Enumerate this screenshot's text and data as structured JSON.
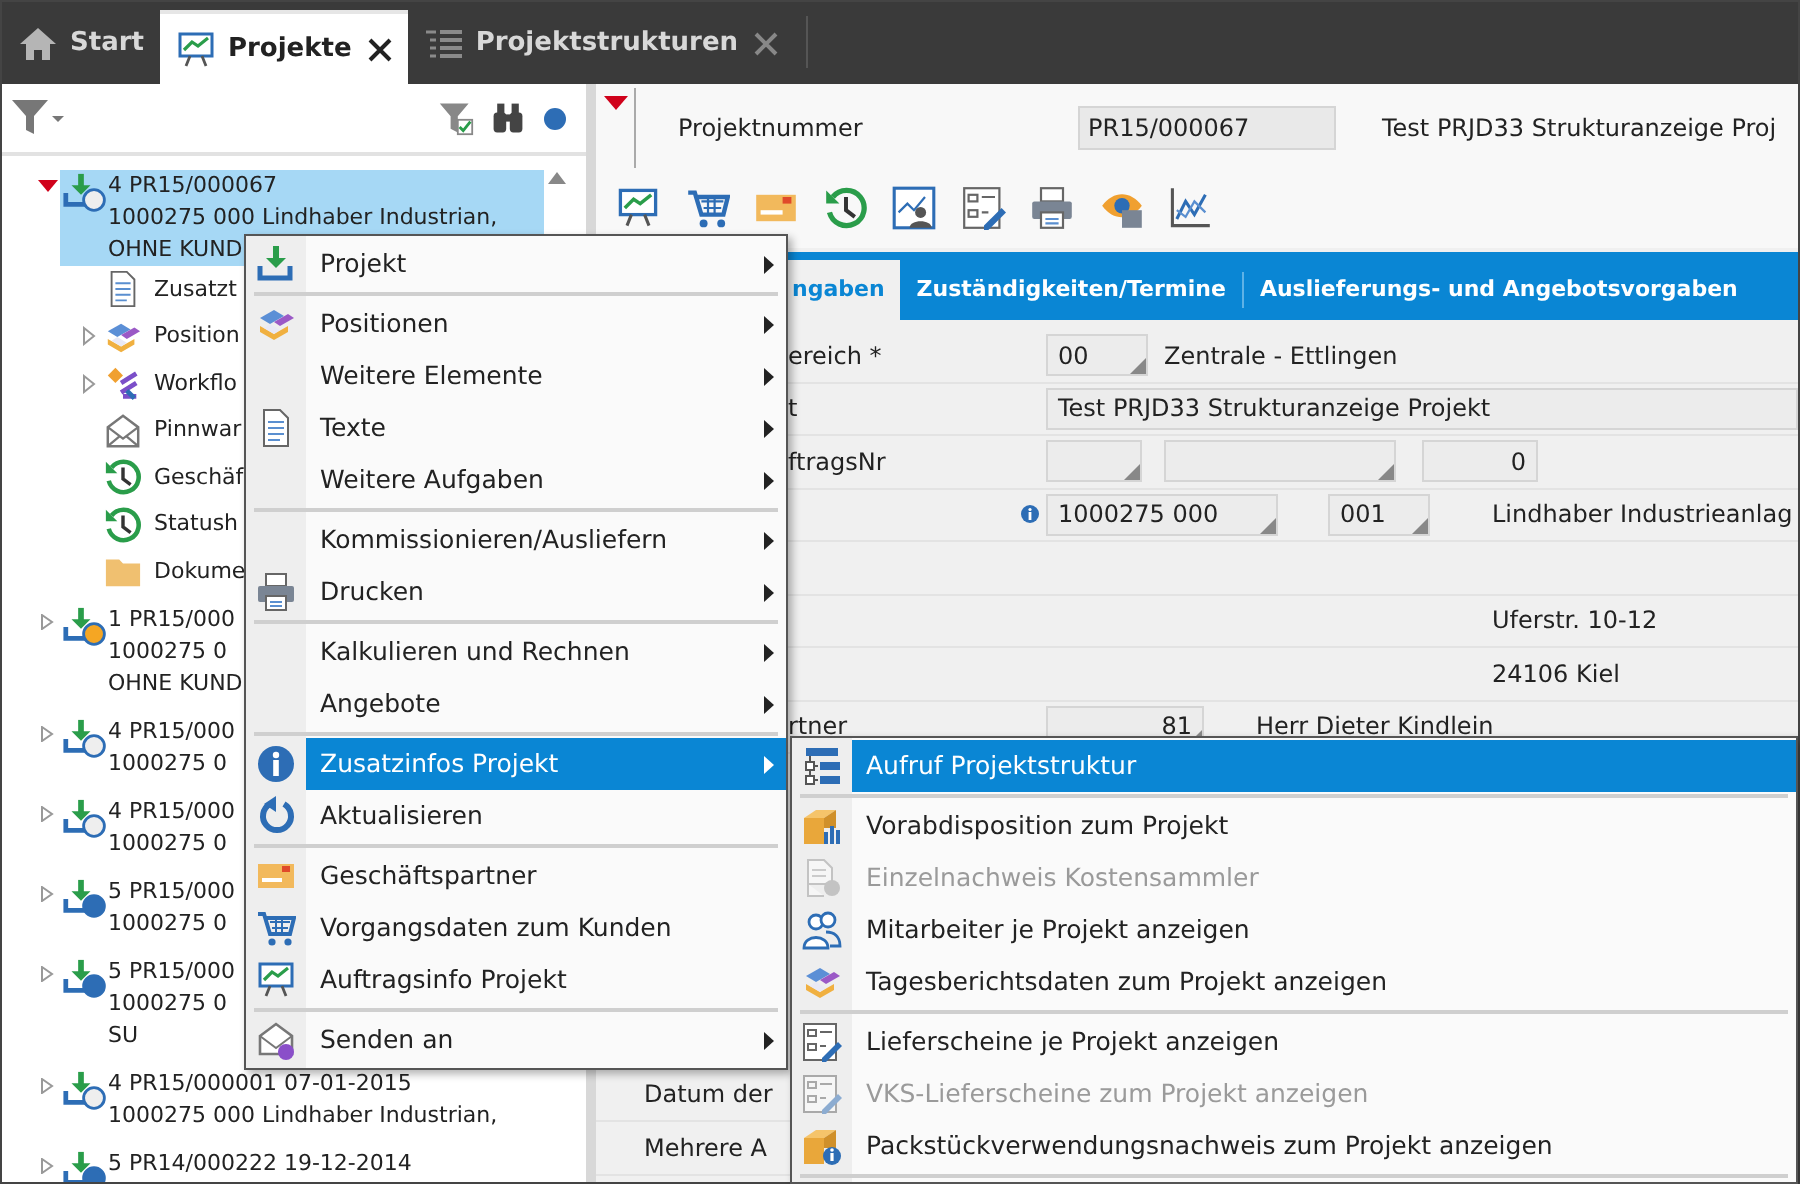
{
  "tabs": [
    {
      "label": "Start",
      "kind": "home",
      "selected": false,
      "closable": false
    },
    {
      "label": "Projekte",
      "kind": "chart",
      "selected": true,
      "closable": true
    },
    {
      "label": "Projektstrukturen",
      "kind": "structure",
      "selected": false,
      "closable": true
    }
  ],
  "tree": [
    {
      "lines": [
        "4 PR15/000067",
        "1000275 000 Lindhaber Industrian,",
        "OHNE KUND"
      ],
      "color": "#eeeeee",
      "selected": true,
      "expanded": true,
      "children": [
        {
          "label": "Zusatzt",
          "kind": "doc",
          "expandable": false
        },
        {
          "label": "Position",
          "kind": "blocks",
          "expandable": true
        },
        {
          "label": "Workflo",
          "kind": "workflow",
          "expandable": true
        },
        {
          "label": "Pinnwar",
          "kind": "envelope",
          "expandable": false
        },
        {
          "label": "Geschäf",
          "kind": "history",
          "expandable": false
        },
        {
          "label": "Statush",
          "kind": "history",
          "expandable": false
        },
        {
          "label": "Dokume",
          "kind": "folder",
          "expandable": false
        }
      ]
    },
    {
      "lines": [
        "1 PR15/000",
        "1000275 0",
        "OHNE KUND"
      ],
      "color": "#f5a623",
      "selected": false,
      "expanded": false
    },
    {
      "lines": [
        "4 PR15/000",
        "1000275 0"
      ],
      "color": "#eeeeee",
      "selected": false,
      "expanded": false
    },
    {
      "lines": [
        "4 PR15/000",
        "1000275 0"
      ],
      "color": "#eeeeee",
      "selected": false,
      "expanded": false
    },
    {
      "lines": [
        "5 PR15/000",
        "1000275 0"
      ],
      "color": "#2d6db5",
      "selected": false,
      "expanded": false
    },
    {
      "lines": [
        "5 PR15/000",
        "1000275 0",
        "SU"
      ],
      "color": "#2d6db5",
      "selected": false,
      "expanded": false
    },
    {
      "lines": [
        "4 PR15/000001 07-01-2015",
        "1000275 000 Lindhaber Industrian,"
      ],
      "color": "#eeeeee",
      "selected": false,
      "expanded": false
    },
    {
      "lines": [
        "5 PR14/000222 19-12-2014"
      ],
      "color": "#2d6db5",
      "selected": false,
      "expanded": false
    }
  ],
  "header": {
    "label": "Projektnummer",
    "value": "PR15/000067",
    "title": "Test PRJD33 Strukturanzeige Proj"
  },
  "toolbar": [
    {
      "kind": "chart"
    },
    {
      "kind": "cart"
    },
    {
      "kind": "card"
    },
    {
      "kind": "history"
    },
    {
      "kind": "person"
    },
    {
      "kind": "form"
    },
    {
      "kind": "printer"
    },
    {
      "kind": "eye"
    },
    {
      "kind": "linechart"
    }
  ],
  "detail_tabs": [
    {
      "label": "ngaben",
      "selected": true
    },
    {
      "label": "Zuständigkeiten/Termine",
      "selected": false
    },
    {
      "label": "Auslieferungs- und Angebotsvorgaben",
      "selected": false
    }
  ],
  "form": [
    {
      "kind": "code",
      "label": "ereich *",
      "value": "00",
      "text": "Zentrale - Ettlingen"
    },
    {
      "kind": "wide",
      "label": "t",
      "value": "Test PRJD33 Strukturanzeige Projekt"
    },
    {
      "kind": "triple",
      "label": "ftragsNr",
      "number": "0"
    },
    {
      "kind": "customer",
      "value": "1000275 000",
      "sub": "001",
      "text": "Lindhaber Industrieanlag"
    },
    {
      "kind": "blank"
    },
    {
      "kind": "address",
      "text": "Uferstr. 10-12"
    },
    {
      "kind": "address",
      "text": "24106 Kiel"
    },
    {
      "kind": "partner",
      "label": "rtner",
      "value": "81",
      "text": "Herr Dieter Kindlein"
    }
  ],
  "bottom_labels": [
    "Datum der",
    "Mehrere A"
  ],
  "context_menu": [
    {
      "label": "Projekt",
      "kind": "tray",
      "submenu": true,
      "selected": false,
      "separator_after": true
    },
    {
      "label": "Positionen",
      "kind": "blocks",
      "submenu": true,
      "selected": false,
      "separator_after": false
    },
    {
      "label": "Weitere Elemente",
      "kind": "plain",
      "submenu": true,
      "selected": false,
      "separator_after": false
    },
    {
      "label": "Texte",
      "kind": "doc",
      "submenu": true,
      "selected": false,
      "separator_after": false
    },
    {
      "label": "Weitere Aufgaben",
      "kind": "plain",
      "submenu": true,
      "selected": false,
      "separator_after": true
    },
    {
      "label": "Kommissionieren/Ausliefern",
      "kind": "plain",
      "submenu": true,
      "selected": false,
      "separator_after": false
    },
    {
      "label": "Drucken",
      "kind": "printer",
      "submenu": true,
      "selected": false,
      "separator_after": true
    },
    {
      "label": "Kalkulieren und Rechnen",
      "kind": "plain",
      "submenu": true,
      "selected": false,
      "separator_after": false
    },
    {
      "label": "Angebote",
      "kind": "plain",
      "submenu": true,
      "selected": false,
      "separator_after": true
    },
    {
      "label": "Zusatzinfos Projekt",
      "kind": "info",
      "submenu": true,
      "selected": true,
      "separator_after": false
    },
    {
      "label": "Aktualisieren",
      "kind": "refresh",
      "submenu": false,
      "selected": false,
      "separator_after": true
    },
    {
      "label": "Geschäftspartner",
      "kind": "card",
      "submenu": false,
      "selected": false,
      "separator_after": false
    },
    {
      "label": "Vorgangsdaten zum Kunden",
      "kind": "cart",
      "submenu": false,
      "selected": false,
      "separator_after": false
    },
    {
      "label": "Auftragsinfo Projekt",
      "kind": "chart",
      "submenu": false,
      "selected": false,
      "separator_after": true
    },
    {
      "label": "Senden an",
      "kind": "send",
      "submenu": true,
      "selected": false,
      "separator_after": false
    }
  ],
  "submenu": [
    {
      "label": "Aufruf Projektstruktur",
      "kind": "structuretree",
      "disabled": false,
      "selected": true,
      "separator_after": true
    },
    {
      "label": "Vorabdisposition zum Projekt",
      "kind": "boxchart",
      "disabled": false,
      "selected": false,
      "separator_after": false
    },
    {
      "label": "Einzelnachweis Kostensammler",
      "kind": "docinfo",
      "disabled": true,
      "selected": false,
      "separator_after": false
    },
    {
      "label": "Mitarbeiter je Projekt anzeigen",
      "kind": "people",
      "disabled": false,
      "selected": false,
      "separator_after": false
    },
    {
      "label": "Tagesberichtsdaten zum Projekt anzeigen",
      "kind": "blocks",
      "disabled": false,
      "selected": false,
      "separator_after": true
    },
    {
      "label": "Lieferscheine je Projekt anzeigen",
      "kind": "form",
      "disabled": false,
      "selected": false,
      "separator_after": false
    },
    {
      "label": "VKS-Lieferscheine zum Projekt anzeigen",
      "kind": "form",
      "disabled": true,
      "selected": false,
      "separator_after": false
    },
    {
      "label": "Packstückverwendungsnachweis zum Projekt anzeigen",
      "kind": "boxinfo",
      "disabled": false,
      "selected": false,
      "separator_after": true
    }
  ]
}
